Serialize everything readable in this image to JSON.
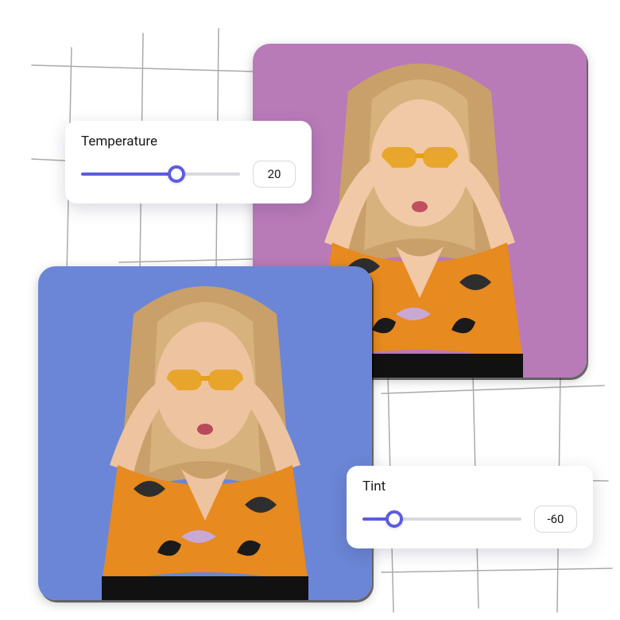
{
  "sliders": {
    "temperature": {
      "label": "Temperature",
      "value": 20,
      "min": -100,
      "max": 100,
      "fill_pct": 60,
      "accent": "#5c5ce0"
    },
    "tint": {
      "label": "Tint",
      "value": -60,
      "min": -100,
      "max": 100,
      "fill_pct": 20,
      "accent": "#5c5ce0"
    }
  },
  "photos": {
    "top_right": {
      "background": "#b97ab8"
    },
    "bottom_left": {
      "background": "#6b86d6"
    }
  }
}
